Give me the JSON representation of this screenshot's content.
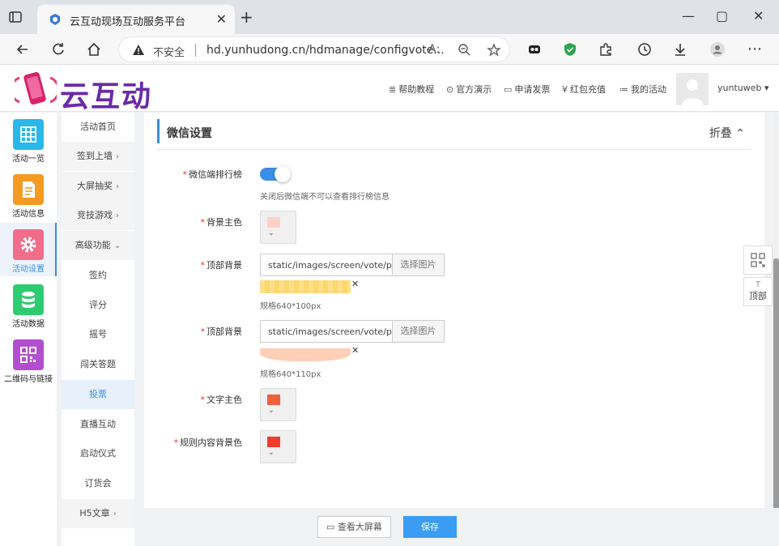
{
  "browser": {
    "tab_title": "云互动现场互动服务平台",
    "new_tab": "+",
    "close_tab": "✕",
    "insecure_label": "不安全",
    "url": "hd.yunhudong.cn/hdmanage/configvote...",
    "min": "—",
    "max": "▢",
    "close": "✕"
  },
  "header": {
    "brand": "云互动",
    "nav": [
      {
        "icon": "≣",
        "label": "帮助教程"
      },
      {
        "icon": "⊙",
        "label": "官方演示"
      },
      {
        "icon": "▭",
        "label": "申请发票"
      },
      {
        "icon": "¥",
        "label": "红包充值"
      },
      {
        "icon": "≔",
        "label": "我的活动"
      }
    ],
    "username": "yuntuweb ▾"
  },
  "sidebar": {
    "items": [
      {
        "label": "活动一览",
        "color": "#2ab7e9"
      },
      {
        "label": "活动信息",
        "color": "#f59a23"
      },
      {
        "label": "活动设置",
        "color": "#f26d8a"
      },
      {
        "label": "活动数据",
        "color": "#2ecc71"
      },
      {
        "label": "二维码与链接",
        "color": "#b14fcf"
      }
    ]
  },
  "submenu": {
    "items": [
      {
        "label": "活动首页",
        "chev": ""
      },
      {
        "label": "签到上墙",
        "chev": "›"
      },
      {
        "label": "大屏抽奖",
        "chev": "›"
      },
      {
        "label": "竞技游戏",
        "chev": "›"
      },
      {
        "label": "高级功能",
        "chev": "⌄"
      },
      {
        "label": "签约",
        "chev": ""
      },
      {
        "label": "评分",
        "chev": ""
      },
      {
        "label": "摇号",
        "chev": ""
      },
      {
        "label": "闯关答题",
        "chev": ""
      },
      {
        "label": "投票",
        "chev": ""
      },
      {
        "label": "直播互动",
        "chev": ""
      },
      {
        "label": "启动仪式",
        "chev": ""
      },
      {
        "label": "订货会",
        "chev": ""
      },
      {
        "label": "H5文章",
        "chev": "›"
      }
    ]
  },
  "section": {
    "title": "微信设置",
    "fold_label": "折叠 ⌃"
  },
  "form": {
    "ranking_label": "微信端排行榜",
    "ranking_hint": "关闭后微信端不可以查看排行榜信息",
    "bg_color_label": "背景主色",
    "bg_color": "#ffd0c4",
    "top_bg1_label": "顶部背景",
    "top_bg1_value": "static/images/screen/vote/pink",
    "top_bg1_spec": "规格640*100px",
    "top_bg2_label": "顶部背景",
    "top_bg2_value": "static/images/screen/vote/pink",
    "top_bg2_spec": "规格640*110px",
    "pick_image": "选择图片",
    "text_color_label": "文字主色",
    "text_color": "#f0603f",
    "rule_bg_label": "规则内容背景色",
    "rule_bg_color": "#f23a2e",
    "req": "*",
    "x": "✕"
  },
  "footer": {
    "screen_btn": "▭ 查看大屏幕",
    "save_btn": "保存"
  },
  "float": {
    "top_label": "顶部",
    "top_arrow": "⊤"
  }
}
